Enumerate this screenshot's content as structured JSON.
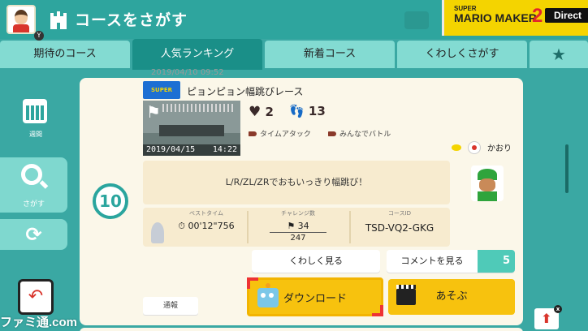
{
  "header": {
    "title": "コースをさがす",
    "avatar_badge": "Y",
    "brand": {
      "super": "SUPER",
      "name": "MARIO MAKER",
      "number": "2",
      "tag": "Direct"
    }
  },
  "tabs": [
    {
      "label": "期待のコース",
      "active": false
    },
    {
      "label": "人気ランキング",
      "active": true
    },
    {
      "label": "新着コース",
      "active": false
    },
    {
      "label": "くわしくさがす",
      "active": false
    }
  ],
  "sidebar": {
    "week_label": "週間",
    "search_label": "さがす"
  },
  "course": {
    "prev_date": "2019/04/10  09:52",
    "logo_text": "SUPER MARIO BROS.",
    "title": "ピョンピョン幅跳びレース",
    "thumb_date": "2019/04/15",
    "thumb_time": "14:22",
    "likes": "2",
    "boos": "13",
    "tags": [
      "タイムアタック",
      "みんなでバトル"
    ],
    "maker": "かおり",
    "rank": "10",
    "description": "L/R/ZL/ZRでおもいっきり幅跳び！",
    "stats": {
      "best_time_label": "ベストタイム",
      "best_time": "00'12\"756",
      "challenge_label": "チャレンジ数",
      "clears": "34",
      "attempts": "247",
      "course_id_label": "コースID",
      "course_id": "TSD-VQ2-GKG"
    }
  },
  "actions": {
    "detail": "くわしく見る",
    "comments": "コメントを見る",
    "comment_count": "5",
    "download": "ダウンロード",
    "play": "あそぶ",
    "report": "通報"
  },
  "watermark": "ファミ通.com",
  "colors": {
    "teal": "#2ea59e",
    "cream": "#fbf7e9",
    "yellow": "#f7c20e",
    "tab_active": "#1a8f88"
  }
}
